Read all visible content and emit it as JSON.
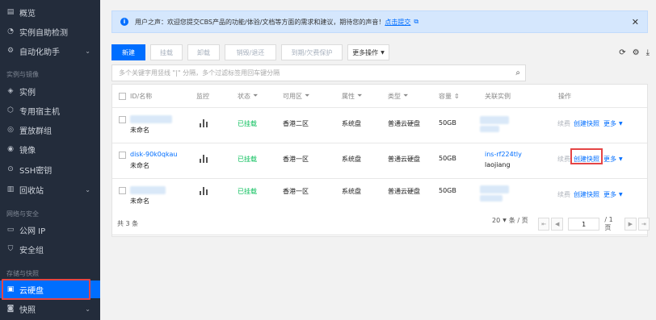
{
  "sidebar": {
    "items": [
      {
        "label": "概览",
        "icon": "overview-icon"
      },
      {
        "label": "实例自助检测",
        "icon": "self-check-icon"
      },
      {
        "label": "自动化助手",
        "icon": "automation-icon"
      },
      {
        "label": "实例",
        "icon": "instance-icon"
      },
      {
        "label": "专用宿主机",
        "icon": "host-icon"
      },
      {
        "label": "置放群组",
        "icon": "placement-icon"
      },
      {
        "label": "镜像",
        "icon": "image-icon"
      },
      {
        "label": "SSH密钥",
        "icon": "ssh-key-icon"
      },
      {
        "label": "回收站",
        "icon": "recycle-bin-icon"
      },
      {
        "label": "公网 IP",
        "icon": "public-ip-icon"
      },
      {
        "label": "安全组",
        "icon": "security-group-icon"
      },
      {
        "label": "云硬盘",
        "icon": "cloud-disk-icon"
      },
      {
        "label": "快照",
        "icon": "snapshot-icon"
      }
    ],
    "groups": {
      "instance_image": "实例与镜像",
      "network_security": "网络与安全",
      "storage_snapshot": "存储与快照"
    }
  },
  "notice": {
    "text": "用户之声：欢迎您提交CBS产品的功能/体验/文档等方面的需求和建议，期待您的声音！",
    "link": "点击提交"
  },
  "toolbar": {
    "new": "新建",
    "mount": "挂载",
    "unmount": "卸载",
    "terminate": "销毁/退还",
    "expire_protect": "到期/欠费保护",
    "more": "更多操作"
  },
  "search": {
    "placeholder": "多个关键字用竖线 \"|\" 分隔，多个过滤标签用回车键分隔"
  },
  "table": {
    "headers": {
      "id": "ID/名称",
      "monitor": "监控",
      "status": "状态",
      "zone": "可用区",
      "attribute": "属性",
      "type": "类型",
      "capacity": "容量",
      "instance": "关联实例",
      "ops": "操作"
    },
    "rows": [
      {
        "id": "",
        "name": "未命名",
        "status": "已挂载",
        "zone": "香港二区",
        "attribute": "系统盘",
        "type": "普通云硬盘",
        "capacity": "50GB",
        "instance_id": "",
        "instance_name": "",
        "renew": "续费",
        "snapshot": "创建快照",
        "more": "更多"
      },
      {
        "id": "disk-90k0qkau",
        "name": "未命名",
        "status": "已挂载",
        "zone": "香港一区",
        "attribute": "系统盘",
        "type": "普通云硬盘",
        "capacity": "50GB",
        "instance_id": "ins-rf224tly",
        "instance_name": "laojiang",
        "renew": "续费",
        "snapshot": "创建快照",
        "more": "更多"
      },
      {
        "id": "",
        "name": "未命名",
        "status": "已挂载",
        "zone": "香港一区",
        "attribute": "系统盘",
        "type": "普通云硬盘",
        "capacity": "50GB",
        "instance_id": "",
        "instance_name": "",
        "renew": "续费",
        "snapshot": "创建快照",
        "more": "更多"
      }
    ]
  },
  "footer": {
    "total": "共 3 条",
    "page_size": "20",
    "page_size_unit": "条 / 页",
    "page": "1",
    "page_total": "/ 1 页"
  }
}
